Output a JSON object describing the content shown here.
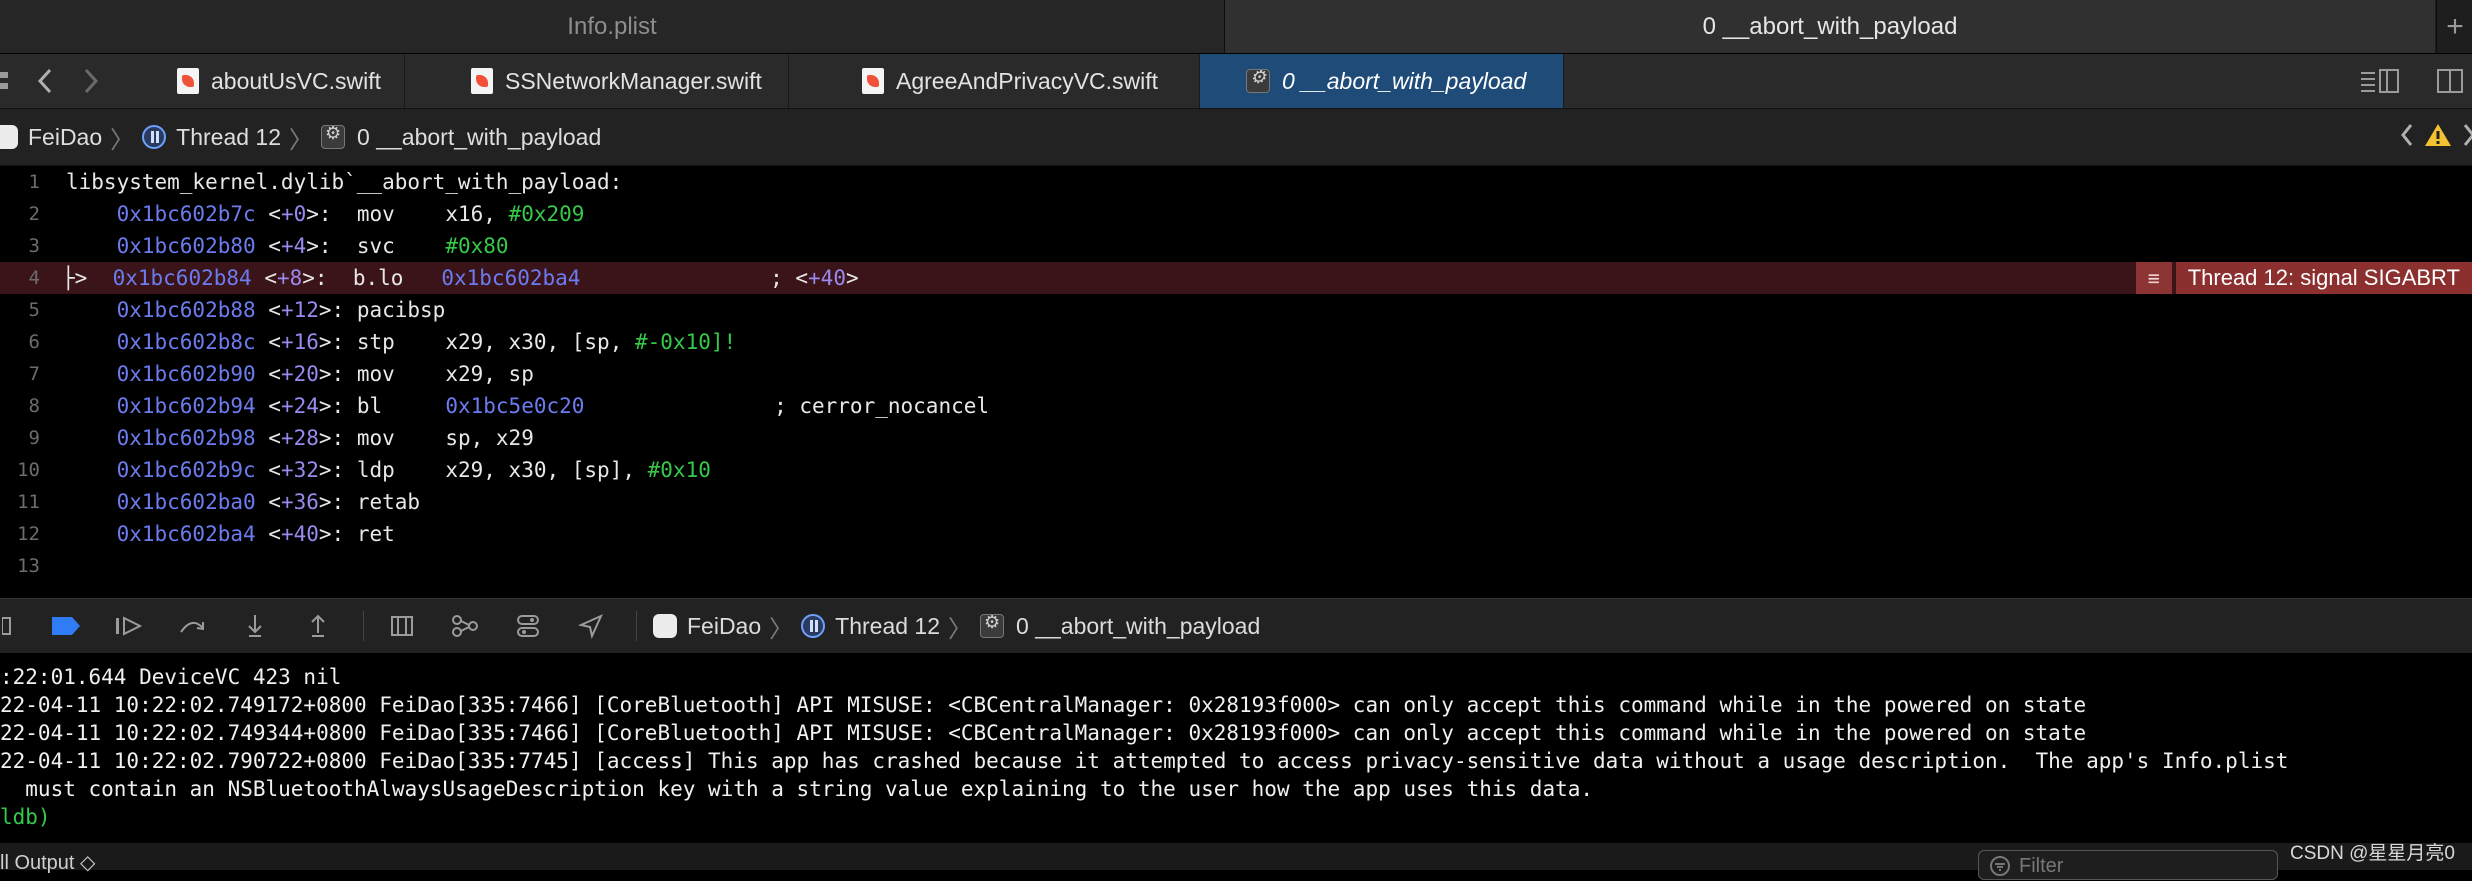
{
  "window_tabs": {
    "left": "Info.plist",
    "right": "0 __abort_with_payload",
    "add": "+"
  },
  "file_tabs": [
    {
      "label": "aboutUsVC.swift"
    },
    {
      "label": "SSNetworkManager.swift"
    },
    {
      "label": "AgreeAndPrivacyVC.swift"
    },
    {
      "label": "0 __abort_with_payload"
    }
  ],
  "jump_bar": {
    "app": "FeiDao",
    "thread": "Thread 12",
    "frame": "0 __abort_with_payload"
  },
  "code": {
    "header": "libsystem_kernel.dylib`__abort_with_payload:",
    "lines": [
      {
        "n": "1"
      },
      {
        "n": "2",
        "addr": "0x1bc602b7c",
        "off": "+0",
        "op": "mov",
        "a": "x16, ",
        "b": "#0x209"
      },
      {
        "n": "3",
        "addr": "0x1bc602b80",
        "off": "+4",
        "op": "svc",
        "b": "#0x80"
      },
      {
        "n": "4",
        "addr": "0x1bc602b84",
        "off": "+8",
        "op": "b.lo",
        "target": "0x1bc602ba4",
        "cm": "; <",
        "cmoff": "+40",
        "cmend": ">"
      },
      {
        "n": "5",
        "addr": "0x1bc602b88",
        "off": "+12",
        "op": "pacibsp"
      },
      {
        "n": "6",
        "addr": "0x1bc602b8c",
        "off": "+16",
        "op": "stp",
        "a": "x29, x30, [sp, ",
        "b": "#-0x10]!"
      },
      {
        "n": "7",
        "addr": "0x1bc602b90",
        "off": "+20",
        "op": "mov",
        "a": "x29, sp"
      },
      {
        "n": "8",
        "addr": "0x1bc602b94",
        "off": "+24",
        "op": "bl",
        "target": "0x1bc5e0c20",
        "cm": "; cerror_nocancel"
      },
      {
        "n": "9",
        "addr": "0x1bc602b98",
        "off": "+28",
        "op": "mov",
        "a": "sp, x29"
      },
      {
        "n": "10",
        "addr": "0x1bc602b9c",
        "off": "+32",
        "op": "ldp",
        "a": "x29, x30, [sp], ",
        "b": "#0x10"
      },
      {
        "n": "11",
        "addr": "0x1bc602ba0",
        "off": "+36",
        "op": "retab"
      },
      {
        "n": "12",
        "addr": "0x1bc602ba4",
        "off": "+40",
        "op": "ret"
      },
      {
        "n": "13"
      }
    ],
    "signal": "Thread 12: signal SIGABRT",
    "arrow": "├>"
  },
  "debug_bar": {
    "app": "FeiDao",
    "thread": "Thread 12",
    "frame": "0 __abort_with_payload"
  },
  "console": {
    "lines": [
      ":22:01.644 DeviceVC 423 nil",
      "22-04-11 10:22:02.749172+0800 FeiDao[335:7466] [CoreBluetooth] API MISUSE: <CBCentralManager: 0x28193f000> can only accept this command while in the powered on state",
      "22-04-11 10:22:02.749344+0800 FeiDao[335:7466] [CoreBluetooth] API MISUSE: <CBCentralManager: 0x28193f000> can only accept this command while in the powered on state",
      "22-04-11 10:22:02.790722+0800 FeiDao[335:7745] [access] This app has crashed because it attempted to access privacy-sensitive data without a usage description.  The app's Info.plist",
      "  must contain an NSBluetoothAlwaysUsageDescription key with a string value explaining to the user how the app uses this data."
    ],
    "prompt": "ldb)"
  },
  "bottom": {
    "output": "ll Output ◇",
    "filter_placeholder": "Filter"
  },
  "watermark": "CSDN @星星月亮0",
  "colors": {
    "address": "#6c7cf0",
    "offset": "#9b89f0",
    "number": "#35c94a",
    "signal_bg": "#8c2f2f",
    "active_tab": "#1f4b78"
  }
}
